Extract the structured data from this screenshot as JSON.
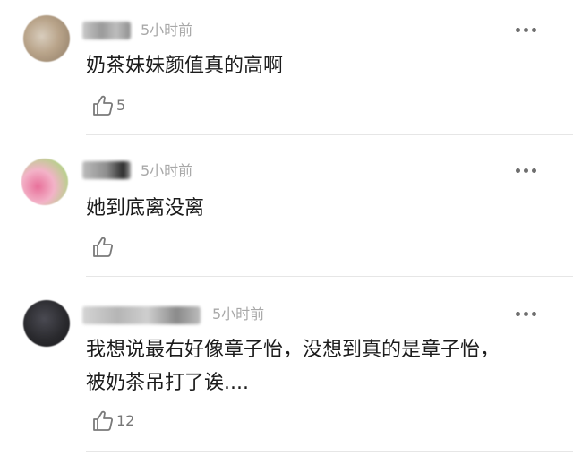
{
  "comments": [
    {
      "time": "5小时前",
      "text": "奶茶妹妹颜值真的高啊",
      "likes": "5",
      "more_icon": "more-dots-icon",
      "like_icon": "thumbs-up-icon",
      "avatar_colors": [
        "#b9a48a",
        "#d8cdbd",
        "#8e7b65"
      ]
    },
    {
      "time": "5小时前",
      "text": "她到底离没离",
      "likes": "",
      "more_icon": "more-dots-icon",
      "like_icon": "thumbs-up-icon",
      "avatar_colors": [
        "#e8709a",
        "#a9d77d",
        "#f3b3c8"
      ]
    },
    {
      "time": "5小时前",
      "text": "我想说最右好像章子怡，没想到真的是章子怡，被奶茶吊打了诶....",
      "likes": "12",
      "more_icon": "more-dots-icon",
      "like_icon": "thumbs-up-icon",
      "avatar_colors": [
        "#2a2a2e",
        "#4a4a52",
        "#18181b"
      ]
    }
  ]
}
